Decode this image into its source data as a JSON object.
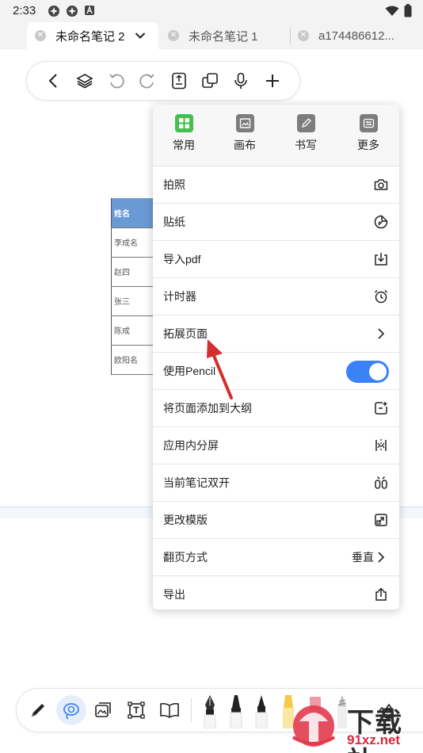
{
  "status_bar": {
    "time": "2:33"
  },
  "tabs": [
    {
      "label": "未命名笔记 2",
      "active": true
    },
    {
      "label": "未命名笔记 1",
      "active": false
    },
    {
      "label": "a174486612...",
      "active": false
    }
  ],
  "top_toolbar": {
    "icons": [
      "back-icon",
      "layers-icon",
      "undo-icon",
      "redo-icon",
      "page-number-icon",
      "copy-icon",
      "microphone-icon",
      "add-icon"
    ]
  },
  "document_table": {
    "rows": [
      "姓名",
      "李成名",
      "赵四",
      "张三",
      "陈成",
      "欧阳名"
    ]
  },
  "popup": {
    "tabs": [
      {
        "label": "常用",
        "icon": "grid-icon",
        "color": "#43c04d"
      },
      {
        "label": "画布",
        "icon": "canvas-icon",
        "color": "#7d7d7d"
      },
      {
        "label": "书写",
        "icon": "pen-icon",
        "color": "#7d7d7d"
      },
      {
        "label": "更多",
        "icon": "more-icon",
        "color": "#7d7d7d"
      }
    ],
    "items": [
      {
        "label": "拍照",
        "icon": "camera-icon"
      },
      {
        "label": "贴纸",
        "icon": "sticker-icon"
      },
      {
        "label": "导入pdf",
        "icon": "import-icon"
      },
      {
        "label": "计时器",
        "icon": "alarm-icon"
      },
      {
        "label": "拓展页面",
        "icon": "chevron-right-icon"
      },
      {
        "label": "使用Pencil",
        "icon": "toggle-on"
      },
      {
        "label": "将页面添加到大纲",
        "icon": "outline-add-icon"
      },
      {
        "label": "应用内分屏",
        "icon": "split-screen-icon"
      },
      {
        "label": "当前笔记双开",
        "icon": "dual-open-icon"
      },
      {
        "label": "更改模版",
        "icon": "template-icon"
      },
      {
        "label": "翻页方式",
        "icon": "chevron-right-icon",
        "value": "垂直"
      },
      {
        "label": "导出",
        "icon": "share-icon"
      }
    ]
  },
  "bottom_toolbar": {
    "icons": [
      "pen-tool-icon",
      "lasso-icon",
      "image-icon",
      "textbox-icon",
      "book-icon",
      "fountain-pen-icon",
      "marker-icon",
      "pencil-tool-icon",
      "highlighter-icon",
      "eraser-icon",
      "crayon-icon",
      "add-tool-icon"
    ]
  },
  "watermark": {
    "text1": "下载站",
    "text2": "91xz.net"
  },
  "colors": {
    "accent": "#3b82f6",
    "toggle_on": "#3b82f6",
    "table_header": "#6a9ad6",
    "arrow": "#d32f2f",
    "watermark_red": "#d9283c"
  }
}
